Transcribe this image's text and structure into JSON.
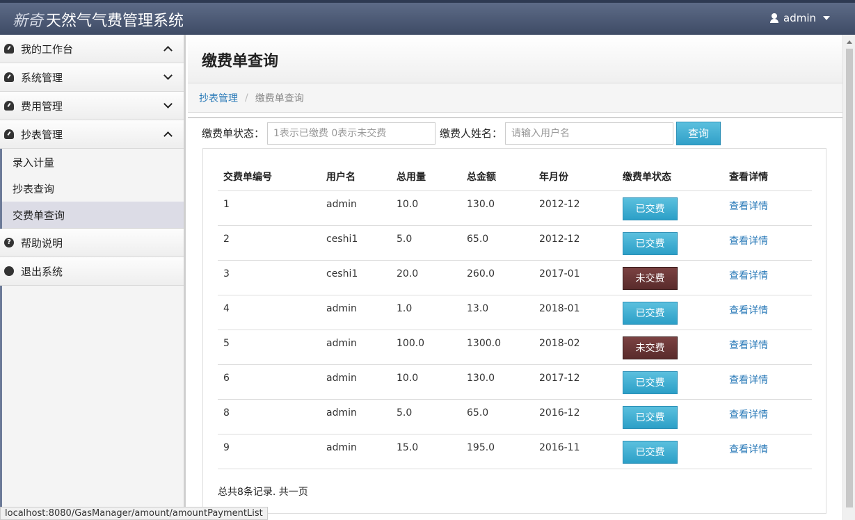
{
  "header": {
    "brand_prefix": "新奇",
    "brand_title": "天然气气费管理系统",
    "user": "admin"
  },
  "sidebar": {
    "items": [
      {
        "label": "我的工作台"
      },
      {
        "label": "系统管理"
      },
      {
        "label": "费用管理"
      },
      {
        "label": "抄表管理"
      }
    ],
    "sub_items": [
      {
        "label": "录入计量"
      },
      {
        "label": "抄表查询"
      },
      {
        "label": "交费单查询"
      }
    ],
    "help": "帮助说明",
    "logout": "退出系统"
  },
  "main": {
    "title": "缴费单查询",
    "breadcrumb": {
      "parent": "抄表管理",
      "current": "缴费单查询"
    },
    "search": {
      "status_label": "缴费单状态：",
      "status_placeholder": "1表示已缴费 0表示未交费",
      "name_label": "缴费人姓名：",
      "name_placeholder": "请输入用户名",
      "button": "查询"
    },
    "table": {
      "headers": [
        "交费单编号",
        "用户名",
        "总用量",
        "总金额",
        "年月份",
        "缴费单状态",
        "查看详情"
      ],
      "rows": [
        {
          "id": "1",
          "user": "admin",
          "usage": "10.0",
          "amount": "130.0",
          "month": "2012-12",
          "status": "已交费",
          "detail": "查看详情"
        },
        {
          "id": "2",
          "user": "ceshi1",
          "usage": "5.0",
          "amount": "65.0",
          "month": "2012-12",
          "status": "已交费",
          "detail": "查看详情"
        },
        {
          "id": "3",
          "user": "ceshi1",
          "usage": "20.0",
          "amount": "260.0",
          "month": "2017-01",
          "status": "未交费",
          "detail": "查看详情"
        },
        {
          "id": "4",
          "user": "admin",
          "usage": "1.0",
          "amount": "13.0",
          "month": "2018-01",
          "status": "已交费",
          "detail": "查看详情"
        },
        {
          "id": "5",
          "user": "admin",
          "usage": "100.0",
          "amount": "1300.0",
          "month": "2018-02",
          "status": "未交费",
          "detail": "查看详情"
        },
        {
          "id": "6",
          "user": "admin",
          "usage": "10.0",
          "amount": "130.0",
          "month": "2017-12",
          "status": "已交费",
          "detail": "查看详情"
        },
        {
          "id": "8",
          "user": "admin",
          "usage": "5.0",
          "amount": "65.0",
          "month": "2016-12",
          "status": "已交费",
          "detail": "查看详情"
        },
        {
          "id": "9",
          "user": "admin",
          "usage": "15.0",
          "amount": "195.0",
          "month": "2016-11",
          "status": "已交费",
          "detail": "查看详情"
        }
      ]
    },
    "summary": "总共8条记录. 共一页"
  },
  "statusbar": {
    "url": "localhost:8080/GasManager/amount/amountPaymentList"
  },
  "colors": {
    "paid": "#31a0c8",
    "unpaid": "#5d2f2f",
    "link": "#2a7ab8",
    "navbar": "#4a5774"
  }
}
